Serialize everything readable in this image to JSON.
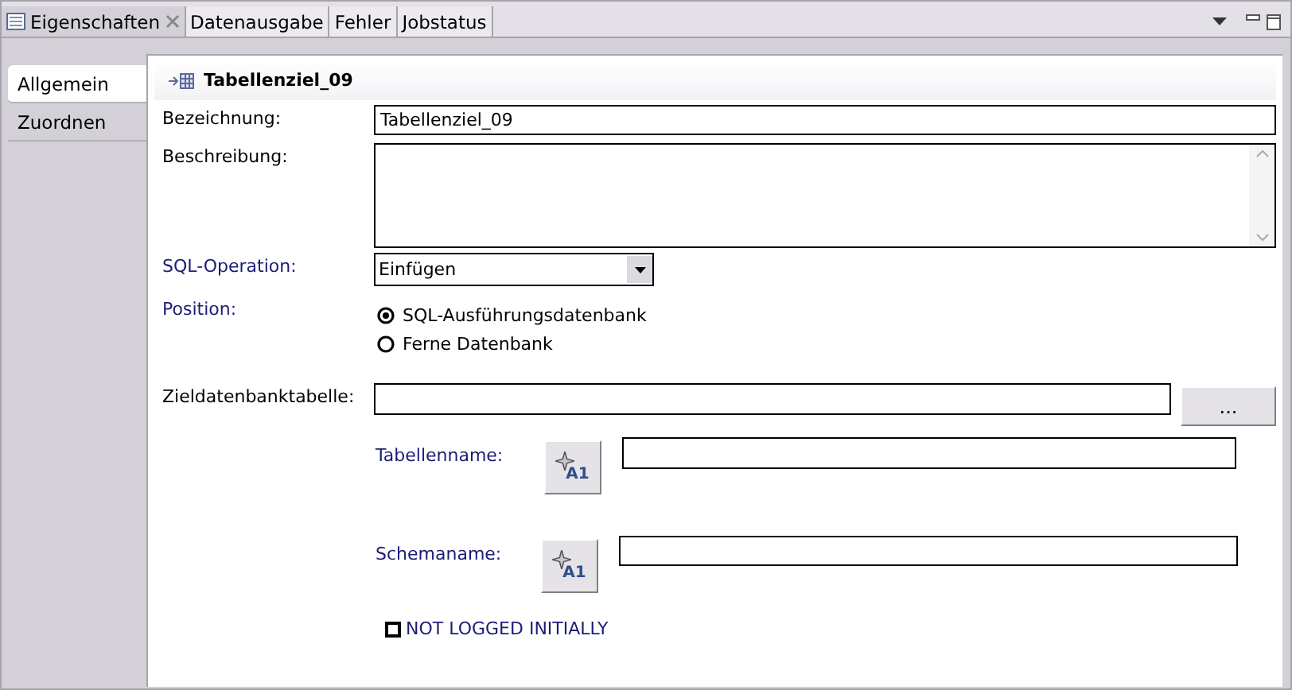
{
  "tabs": [
    {
      "label": "Eigenschaften",
      "selected": true,
      "closable": true
    },
    {
      "label": "Datenausgabe",
      "selected": false,
      "closable": false
    },
    {
      "label": "Fehler",
      "selected": false,
      "closable": false
    },
    {
      "label": "Jobstatus",
      "selected": false,
      "closable": false
    }
  ],
  "sidebar": {
    "items": [
      {
        "label": "Allgemein",
        "selected": true
      },
      {
        "label": "Zuordnen",
        "selected": false
      }
    ]
  },
  "header": {
    "title": "Tabellenziel_09"
  },
  "form": {
    "bezeichnung": {
      "label": "Bezeichnung:",
      "value": "Tabellenziel_09"
    },
    "beschreibung": {
      "label": "Beschreibung:"
    },
    "sql_operation": {
      "label": "SQL-Operation:",
      "value": "Einfügen"
    },
    "position": {
      "label": "Position:",
      "options": [
        {
          "label": "SQL-Ausführungsdatenbank",
          "selected": true
        },
        {
          "label": "Ferne Datenbank",
          "selected": false
        }
      ]
    },
    "zieldatenbanktabelle": {
      "label": "Zieldatenbanktabelle:",
      "button": "..."
    },
    "tabellenname": {
      "label": "Tabellenname:",
      "button": "A1"
    },
    "schemaname": {
      "label": "Schemaname:",
      "button": "A1"
    },
    "not_logged_initially": {
      "label": "NOT LOGGED INITIALLY",
      "checked": false
    }
  }
}
